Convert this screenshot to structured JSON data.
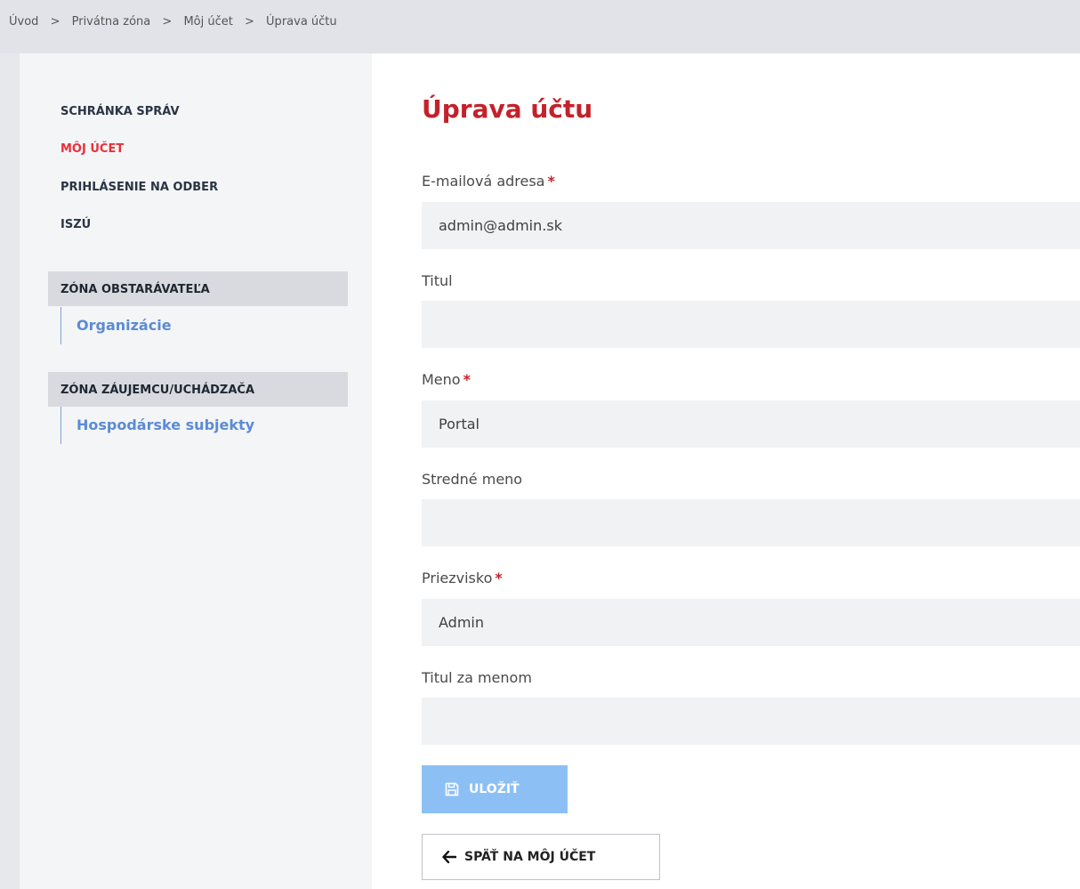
{
  "breadcrumb": {
    "items": [
      "Úvod",
      "Privátna zóna",
      "Môj účet",
      "Úprava účtu"
    ],
    "separator": ">"
  },
  "sidebar": {
    "nav": [
      {
        "label": "SCHRÁNKA SPRÁV",
        "active": false
      },
      {
        "label": "MÔJ ÚČET",
        "active": true
      },
      {
        "label": "PRIHLÁSENIE NA ODBER",
        "active": false
      },
      {
        "label": "ISZÚ",
        "active": false
      }
    ],
    "zones": [
      {
        "title": "ZÓNA OBSTARÁVATEĽA",
        "links": [
          "Organizácie"
        ]
      },
      {
        "title": "ZÓNA ZÁUJEMCU/UCHÁDZAČA",
        "links": [
          "Hospodárske subjekty"
        ]
      }
    ]
  },
  "main": {
    "title": "Úprava účtu",
    "required_marker": "*",
    "fields": [
      {
        "label": "E-mailová adresa",
        "required": true,
        "value": "admin@admin.sk"
      },
      {
        "label": "Titul",
        "required": false,
        "value": ""
      },
      {
        "label": "Meno",
        "required": true,
        "value": "Portal"
      },
      {
        "label": "Stredné meno",
        "required": false,
        "value": ""
      },
      {
        "label": "Priezvisko",
        "required": true,
        "value": "Admin"
      },
      {
        "label": "Titul za menom",
        "required": false,
        "value": ""
      }
    ],
    "save_label": "ULOŽIŤ",
    "back_label": "SPÄŤ NA MÔJ ÚČET"
  },
  "colors": {
    "accent_red": "#c4212b",
    "active_nav": "#e8303a",
    "link_blue": "#5b8bd4",
    "save_button": "#8cc0f4"
  },
  "icons": {
    "save": "floppy-disk-icon",
    "back": "arrow-left-icon"
  }
}
